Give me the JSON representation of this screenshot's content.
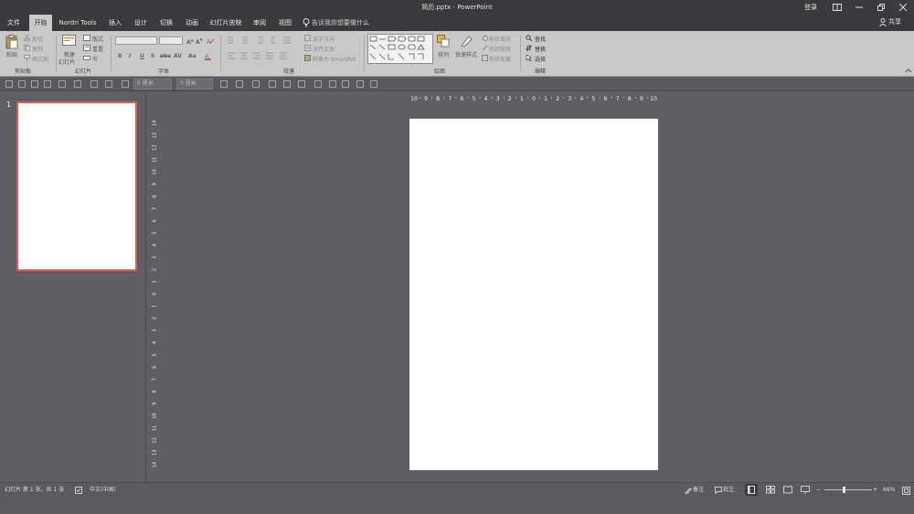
{
  "window": {
    "title": "简历.pptx  -  PowerPoint",
    "login": "登录",
    "share": "共享"
  },
  "tabs": [
    {
      "label": "文件"
    },
    {
      "label": "开始"
    },
    {
      "label": "Nordri Tools"
    },
    {
      "label": "插入"
    },
    {
      "label": "设计"
    },
    {
      "label": "切换"
    },
    {
      "label": "动画"
    },
    {
      "label": "幻灯片放映"
    },
    {
      "label": "审阅"
    },
    {
      "label": "视图"
    }
  ],
  "tell_me": "告诉我你想要做什么",
  "ribbon": {
    "clipboard": {
      "paste": "粘贴",
      "cut": "剪切",
      "copy": "复制",
      "format_painter": "格式刷",
      "label": "剪贴板"
    },
    "slides": {
      "new_slide_line1": "新建",
      "new_slide_line2": "幻灯片",
      "layout": "版式",
      "reset": "重置",
      "section": "节",
      "label": "幻灯片"
    },
    "font": {
      "label": "字体",
      "bold": "B",
      "italic": "I",
      "underline": "U",
      "strike": "S",
      "shadow": "abc",
      "spacing": "AV",
      "case": "Aa"
    },
    "paragraph": {
      "text_direction": "文字方向",
      "align_text": "对齐文本",
      "smartart": "转换为 SmartArt",
      "label": "段落"
    },
    "drawing": {
      "arrange": "排列",
      "quick_styles": "快速样式",
      "fill": "形状填充",
      "outline": "形状轮廓",
      "effects": "形状效果",
      "label": "绘图"
    },
    "editing": {
      "find": "查找",
      "replace": "替换",
      "select": "选择",
      "label": "编辑"
    }
  },
  "toolbar2": {
    "height_value": "0 厘米",
    "width_value": "0 厘米"
  },
  "slide_panel": {
    "slide_number": "1"
  },
  "ruler": {
    "horizontal_ticks": [
      "10",
      "9",
      "8",
      "7",
      "6",
      "5",
      "4",
      "3",
      "2",
      "1",
      "0",
      "1",
      "2",
      "3",
      "4",
      "5",
      "6",
      "7",
      "8",
      "9",
      "10"
    ],
    "vertical_ticks": [
      "14",
      "13",
      "12",
      "11",
      "10",
      "9",
      "8",
      "7",
      "6",
      "5",
      "4",
      "3",
      "2",
      "1",
      "0",
      "1",
      "2",
      "3",
      "4",
      "5",
      "6",
      "7",
      "8",
      "9",
      "10",
      "11",
      "12",
      "13",
      "14"
    ]
  },
  "status": {
    "slide_info": "幻灯片 第 1 张，共 1 张",
    "language": "中文(中国)",
    "notes": "备注",
    "comments": "批注",
    "zoom": "66%",
    "zoom_level_fraction": 0.4
  },
  "colors": {
    "accent_selected_thumb": "#e05a47",
    "titlebar": "#3a3a3c",
    "ribbon": "#c9c9c9",
    "workspace": "#5f5f63"
  }
}
